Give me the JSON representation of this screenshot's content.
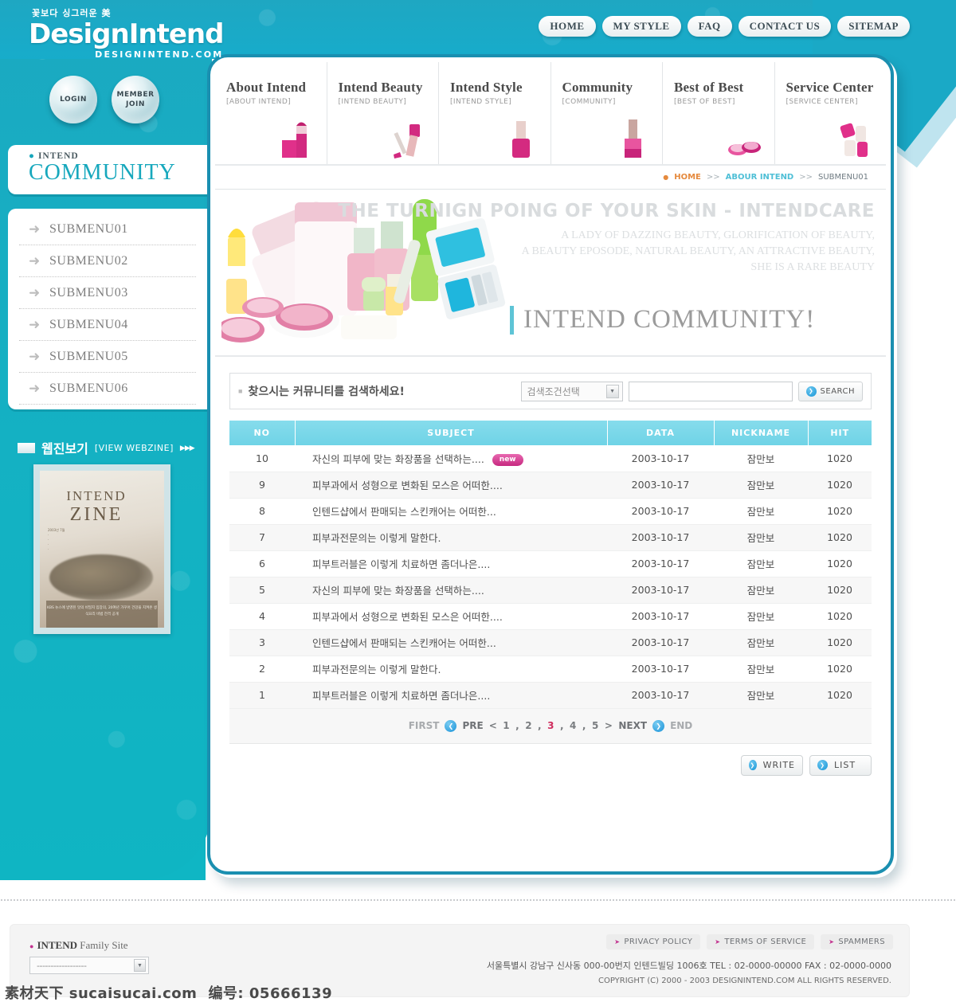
{
  "brand": {
    "tagline_kr": "꽃보다 싱그러운 美",
    "name": "DesignIntend",
    "domain": "DESIGNINTEND.COM"
  },
  "topnav": [
    {
      "label": "HOME"
    },
    {
      "label": "MY STYLE"
    },
    {
      "label": "FAQ"
    },
    {
      "label": "CONTACT US"
    },
    {
      "label": "SITEMAP"
    }
  ],
  "orbs": [
    {
      "label": "LOGIN"
    },
    {
      "label": "MEMBER JOIN"
    }
  ],
  "left": {
    "kicker_bullet": "●",
    "kicker": "INTEND",
    "title": "COMMUNITY",
    "items": [
      {
        "label": "SUBMENU01"
      },
      {
        "label": "SUBMENU02"
      },
      {
        "label": "SUBMENU03"
      },
      {
        "label": "SUBMENU04"
      },
      {
        "label": "SUBMENU05"
      },
      {
        "label": "SUBMENU06"
      }
    ],
    "webzine": {
      "title_kr": "웹진보기",
      "title_en": "[VIEW WEBZINE]",
      "arrows": "▶▶▶",
      "cover_line1": "INTEND",
      "cover_line2": "ZINE",
      "cover_caption": "KBS 뉴스에 방영된 맛의 비밀지 입장의, 20여년 가꾸어 건강을 지켜온 생식요리 비법 전격 공개"
    }
  },
  "gnb": [
    {
      "title": "About Intend",
      "sub": "[ABOUT INTEND]",
      "icon": "lipstick-icon"
    },
    {
      "title": "Intend Beauty",
      "sub": "[INTEND BEAUTY]",
      "icon": "mascara-icon"
    },
    {
      "title": "Intend Style",
      "sub": "[INTEND STYLE]",
      "icon": "nail-polish-icon"
    },
    {
      "title": "Community",
      "sub": "[COMMUNITY]",
      "icon": "nail-brush-icon"
    },
    {
      "title": "Best of Best",
      "sub": "[BEST OF BEST]",
      "icon": "compact-icon"
    },
    {
      "title": "Service Center",
      "sub": "[SERVICE CENTER]",
      "icon": "cream-tubes-icon"
    }
  ],
  "breadcrumb": {
    "home": "HOME",
    "sep1": ">>",
    "second": "ABOUR INTEND",
    "sep2": ">>",
    "current": "SUBMENU01"
  },
  "banner": {
    "headline": "THE TURNIGN POING OF YOUR SKIN - INTENDCARE",
    "sub_line1": "A LADY OF DAZZING BEAUTY, GLORIFICATION OF BEAUTY,",
    "sub_line2": "A BEAUTY EPOSODE, NATURAL BEAUTY, AN ATTRACTIVE BEAUTY,",
    "sub_line3": "SHE IS A RARE BEAUTY",
    "title": "INTEND COMMUNITY!"
  },
  "search": {
    "label": "찾으시는 커뮤니티를 검색하세요!",
    "select_value": "검색조건선택",
    "input_value": "",
    "input_placeholder": "",
    "button": "SEARCH"
  },
  "table": {
    "headers": [
      "NO",
      "SUBJECT",
      "DATA",
      "NICKNAME",
      "HIT"
    ],
    "rows": [
      {
        "no": "10",
        "subject": "자신의 피부에 맞는 화장품을 선택하는....",
        "new": "new",
        "date": "2003-10-17",
        "nickname": "잠만보",
        "hit": "1020"
      },
      {
        "no": "9",
        "subject": "피부과에서 성형으로 변화된 모스은 어떠한....",
        "new": "",
        "date": "2003-10-17",
        "nickname": "잠만보",
        "hit": "1020"
      },
      {
        "no": "8",
        "subject": "인텐드샵에서 판매되는 스킨캐어는 어떠한...",
        "new": "",
        "date": "2003-10-17",
        "nickname": "잠만보",
        "hit": "1020"
      },
      {
        "no": "7",
        "subject": "피부과전문의는 이렇게 말한다.",
        "new": "",
        "date": "2003-10-17",
        "nickname": "잠만보",
        "hit": "1020"
      },
      {
        "no": "6",
        "subject": "피부트러블은 이렇게 치료하면 좀더나은....",
        "new": "",
        "date": "2003-10-17",
        "nickname": "잠만보",
        "hit": "1020"
      },
      {
        "no": "5",
        "subject": "자신의 피부에 맞는 화장품을 선택하는....",
        "new": "",
        "date": "2003-10-17",
        "nickname": "잠만보",
        "hit": "1020"
      },
      {
        "no": "4",
        "subject": "피부과에서 성형으로 변화된 모스은 어떠한....",
        "new": "",
        "date": "2003-10-17",
        "nickname": "잠만보",
        "hit": "1020"
      },
      {
        "no": "3",
        "subject": "인텐드샵에서 판매되는 스킨캐어는 어떠한...",
        "new": "",
        "date": "2003-10-17",
        "nickname": "잠만보",
        "hit": "1020"
      },
      {
        "no": "2",
        "subject": "피부과전문의는 이렇게 말한다.",
        "new": "",
        "date": "2003-10-17",
        "nickname": "잠만보",
        "hit": "1020"
      },
      {
        "no": "1",
        "subject": "피부트러블은 이렇게 치료하면 좀더나은....",
        "new": "",
        "date": "2003-10-17",
        "nickname": "잠만보",
        "hit": "1020"
      }
    ]
  },
  "pager": {
    "first": "FIRST",
    "pre": "PRE",
    "open": "<",
    "pages": [
      "1",
      "2",
      "3",
      "4",
      "5"
    ],
    "current": "3",
    "close": ">",
    "next": "NEXT",
    "end": "END"
  },
  "actions": [
    {
      "label": "WRITE"
    },
    {
      "label": "LIST"
    }
  ],
  "footer": {
    "family_bullet": "●",
    "family_brand": "INTEND",
    "family_label": "Family Site",
    "family_select_value": "------------------",
    "links": [
      {
        "label": "PRIVACY POLICY"
      },
      {
        "label": "TERMS OF SERVICE"
      },
      {
        "label": "SPAMMERS"
      }
    ],
    "address": "서울특별시  강남구 신사동 000-00번지 인텐드빌딩 1006호  TEL : 02-0000-00000  FAX : 02-0000-0000",
    "copyright": "COPYRIGHT (C) 2000 - 2003 DESIGNINTEND.COM  ALL RIGHTS RESERVED."
  },
  "watermark": {
    "site": "素材天下 sucaisucai.com",
    "code": "编号: 05666139"
  },
  "colors": {
    "teal": "#15b0c4",
    "panel_border": "#1a8fb0",
    "table_header": "#78d7e9",
    "pink_badge": "#d8399a",
    "accent_blue": "#1b93d8",
    "current_page": "#cf2d5e"
  }
}
